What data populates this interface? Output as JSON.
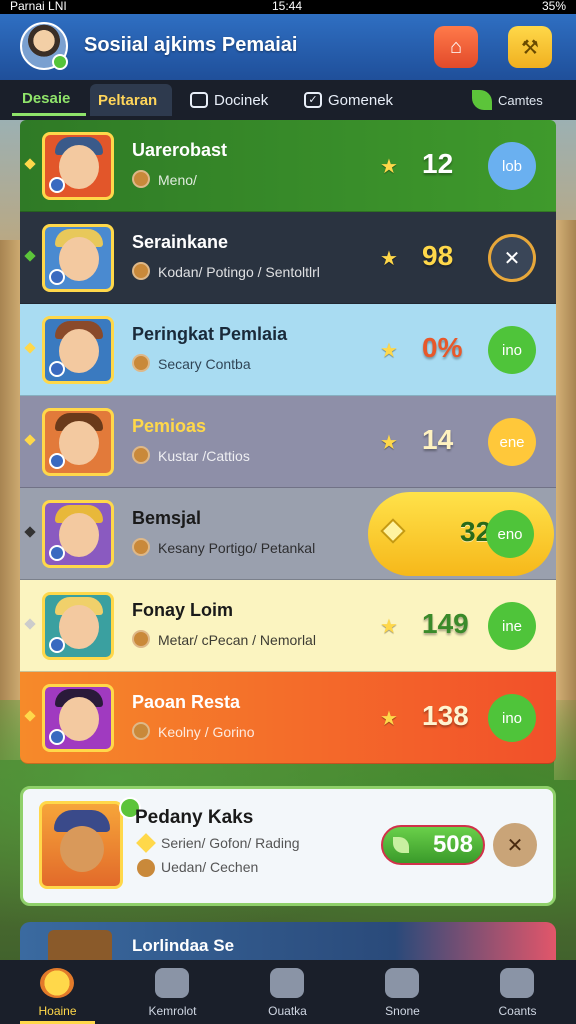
{
  "status_bar": {
    "carrier": "Parnai LNI",
    "time": "15:44",
    "battery": "35%"
  },
  "header": {
    "title": "Sosiial ajkims Pemaiai"
  },
  "tabs": [
    {
      "label": "Desaie"
    },
    {
      "label": "Peltaran"
    },
    {
      "label": "Docinek"
    },
    {
      "label": "Gomenek"
    },
    {
      "label": "Camtes"
    }
  ],
  "rows": [
    {
      "name": "Uarerobast",
      "sub": "Meno/",
      "score": "12",
      "action": "lob"
    },
    {
      "name": "Serainkane",
      "sub": "Kodan/ Potingo / Sentoltlrl",
      "score": "98",
      "action": ""
    },
    {
      "name": "Peringkat Pemlaia",
      "sub": "Secary Contba",
      "score": "0%",
      "action": "ino"
    },
    {
      "name": "Pemioas",
      "sub": "Kustar /Cattios",
      "score": "14",
      "action": "ene"
    },
    {
      "name": "Bemsjal",
      "sub": "Kesany Portigo/ Petankal",
      "score": "32",
      "action": "eno"
    },
    {
      "name": "Fonay Loim",
      "sub": "Metar/ cPecan / Nemorlal",
      "score": "149",
      "action": "ine"
    },
    {
      "name": "Paoan Resta",
      "sub": "Keolny / Gorino",
      "score": "138",
      "action": "ino"
    }
  ],
  "featured": {
    "name": "Pedany Kaks",
    "sub1": "Serien/ Gofon/ Rading",
    "sub2": "Uedan/ Cechen",
    "score": "508"
  },
  "peek_row": {
    "name": "Lorlindaa Se"
  },
  "nav": [
    {
      "label": "Hoaine"
    },
    {
      "label": "Kemrolot"
    },
    {
      "label": "Ouatka"
    },
    {
      "label": "Snone"
    },
    {
      "label": "Coants"
    }
  ]
}
